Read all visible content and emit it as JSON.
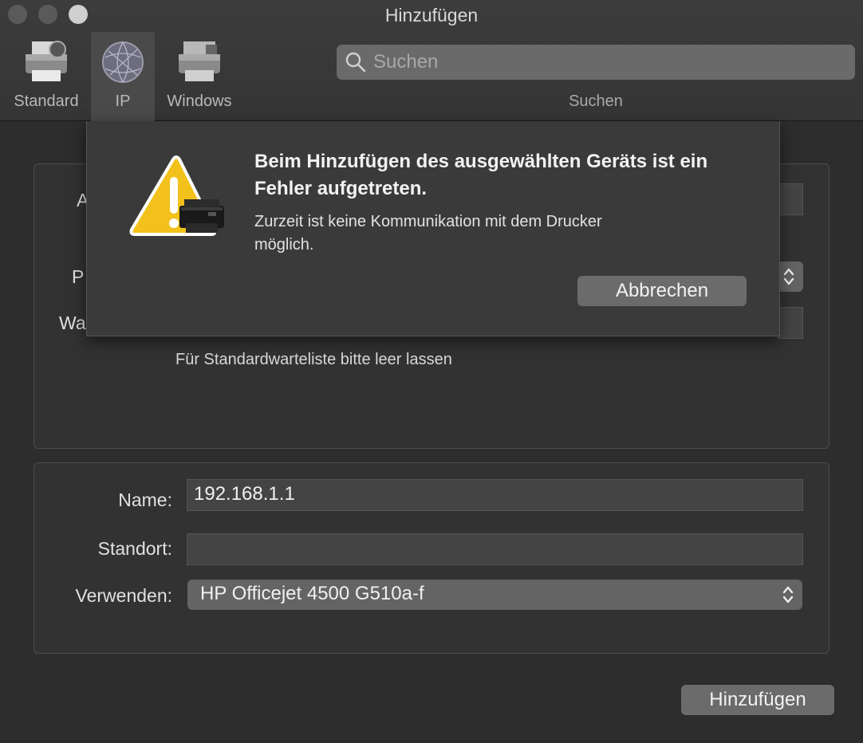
{
  "window": {
    "title": "Hinzufügen"
  },
  "toolbar": {
    "items": [
      {
        "label": "Standard",
        "icon": "printer-icon"
      },
      {
        "label": "IP",
        "icon": "globe-icon",
        "selected": true
      },
      {
        "label": "Windows",
        "icon": "windows-printer-icon"
      }
    ],
    "search": {
      "placeholder": "Suchen",
      "label": "Suchen"
    }
  },
  "form": {
    "hidden_labels": [
      "A",
      "P",
      "Wa"
    ],
    "hint": "Für Standardwarteliste bitte leer lassen",
    "name_label": "Name:",
    "name_value": "192.168.1.1",
    "location_label": "Standort:",
    "location_value": "",
    "use_label": "Verwenden:",
    "use_value": "HP Officejet 4500 G510a-f",
    "add_button": "Hinzufügen"
  },
  "alert": {
    "title": "Beim Hinzufügen des ausgewählten Geräts ist ein Fehler aufgetreten.",
    "message": "Zurzeit ist keine Kommunikation mit dem Drucker möglich.",
    "cancel_button": "Abbrechen",
    "icon": "warning-printer-icon"
  },
  "colors": {
    "warning": "#f2c11b",
    "background": "#2d2d2d"
  }
}
